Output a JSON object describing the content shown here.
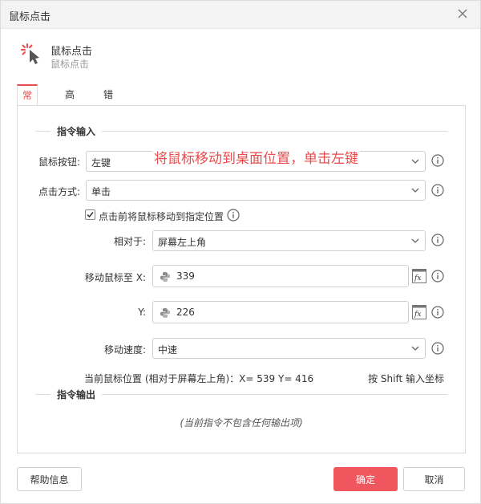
{
  "window": {
    "title": "鼠标点击"
  },
  "header": {
    "name": "鼠标点击",
    "subtitle": "鼠标点击"
  },
  "tabs": [
    {
      "label": "常规",
      "active": true
    },
    {
      "label": "高级",
      "active": false
    },
    {
      "label": "错误处理",
      "active": false
    }
  ],
  "input_section": {
    "title": "指令输入"
  },
  "annotation": "将鼠标移动到桌面位置，单击左键",
  "mouse_button": {
    "label": "鼠标按钮:",
    "value": "左键"
  },
  "click_mode": {
    "label": "点击方式:",
    "value": "单击"
  },
  "move_checkbox": {
    "label": "点击前将鼠标移动到指定位置",
    "checked": true
  },
  "relative_to": {
    "label": "相对于:",
    "value": "屏幕左上角"
  },
  "move_x": {
    "label": "移动鼠标至  X:",
    "value": "339"
  },
  "move_y": {
    "label": "Y:",
    "value": "226"
  },
  "move_speed": {
    "label": "移动速度:",
    "value": "中速"
  },
  "cursor_position": "当前鼠标位置 (相对于屏幕左上角)：X= 539 Y= 416",
  "shift_hint": "按 Shift 输入坐标",
  "output_section": {
    "title": "指令输出",
    "empty_text": "(当前指令不包含任何输出项)"
  },
  "buttons": {
    "help": "帮助信息",
    "ok": "确定",
    "cancel": "取消"
  },
  "colors": {
    "accent": "#e84c4c",
    "primary_button": "#f0565d"
  },
  "icons": [
    "close-icon",
    "mouse-click-icon",
    "chevron-down-icon",
    "info-icon",
    "python-icon",
    "fx-icon",
    "checkmark-icon"
  ]
}
